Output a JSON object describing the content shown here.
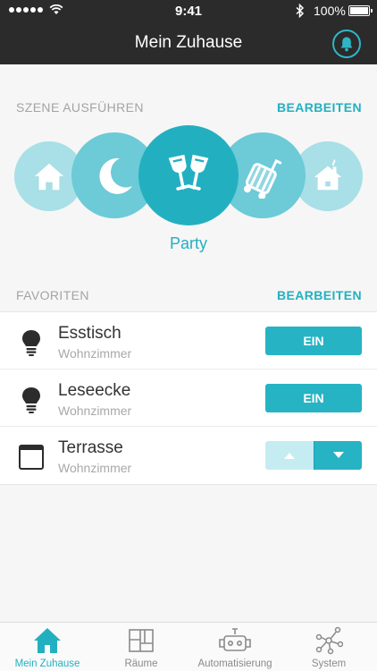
{
  "status_bar": {
    "time": "9:41",
    "battery": "100%"
  },
  "header": {
    "title": "Mein Zuhause"
  },
  "scenes_section": {
    "label": "SZENE AUSFÜHREN",
    "edit_label": "BEARBEITEN",
    "selected_scene": "Party",
    "scenes": [
      {
        "icon": "house-icon"
      },
      {
        "icon": "moon-icon"
      },
      {
        "icon": "wine-glasses-icon"
      },
      {
        "icon": "suitcase-icon"
      },
      {
        "icon": "house-chimney-icon"
      }
    ]
  },
  "favorites_section": {
    "label": "FAVORITEN",
    "edit_label": "BEARBEITEN",
    "items": [
      {
        "name": "Esstisch",
        "room": "Wohnzimmer",
        "icon": "light-bulb-icon",
        "action": "EIN"
      },
      {
        "name": "Leseecke",
        "room": "Wohnzimmer",
        "icon": "light-bulb-icon",
        "action": "EIN"
      },
      {
        "name": "Terrasse",
        "room": "Wohnzimmer",
        "icon": "window-shutter-icon"
      }
    ]
  },
  "tabs": [
    {
      "label": "Mein Zuhause",
      "icon": "home-icon",
      "active": true
    },
    {
      "label": "Räume",
      "icon": "rooms-icon"
    },
    {
      "label": "Automatisierung",
      "icon": "robot-icon"
    },
    {
      "label": "System",
      "icon": "network-icon"
    }
  ],
  "colors": {
    "accent": "#22b0c1",
    "header_bg": "#2b2b2b",
    "background": "#f6f6f6"
  }
}
